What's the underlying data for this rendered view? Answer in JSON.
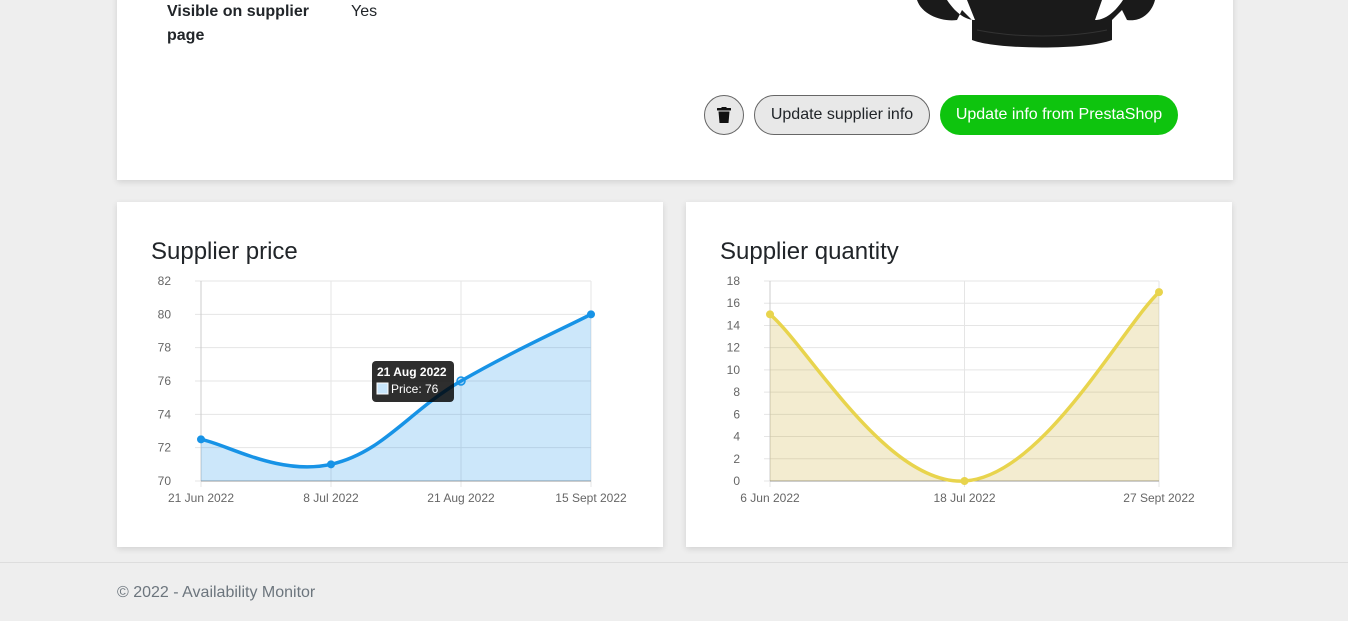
{
  "details": {
    "visible_label": "Visible on supplier page",
    "visible_value": "Yes"
  },
  "actions": {
    "delete_icon": "trash-icon",
    "update_supplier_label": "Update supplier info",
    "update_prestashop_label": "Update info from PrestaShop",
    "accent": "#0ec40e"
  },
  "price_chart": {
    "title": "Supplier price",
    "tooltip_title": "21 Aug 2022",
    "tooltip_body": "Price: 76",
    "chart_data": {
      "type": "line",
      "title": "Supplier price",
      "x": [
        "21 Jun 2022",
        "8 Jul 2022",
        "21 Aug 2022",
        "15 Sept 2022"
      ],
      "series": [
        {
          "name": "Price",
          "values": [
            72.5,
            71,
            76,
            80
          ]
        }
      ],
      "ylim": [
        70,
        82
      ],
      "yticks": [
        "82",
        "80",
        "78",
        "76",
        "74",
        "72",
        "70"
      ],
      "grid": true,
      "fill": true,
      "color": "#1793e6"
    }
  },
  "qty_chart": {
    "title": "Supplier quantity",
    "chart_data": {
      "type": "line",
      "title": "Supplier quantity",
      "x": [
        "6 Jun 2022",
        "18 Jul 2022",
        "27 Sept 2022"
      ],
      "series": [
        {
          "values": [
            15,
            0,
            17
          ]
        }
      ],
      "ylim": [
        0,
        18
      ],
      "yticks": [
        "18",
        "16",
        "14",
        "12",
        "10",
        "8",
        "6",
        "4",
        "2",
        "0"
      ],
      "grid": true,
      "fill": true,
      "color": "#e8d44d"
    }
  },
  "footer": {
    "text": "© 2022 - Availability Monitor"
  }
}
